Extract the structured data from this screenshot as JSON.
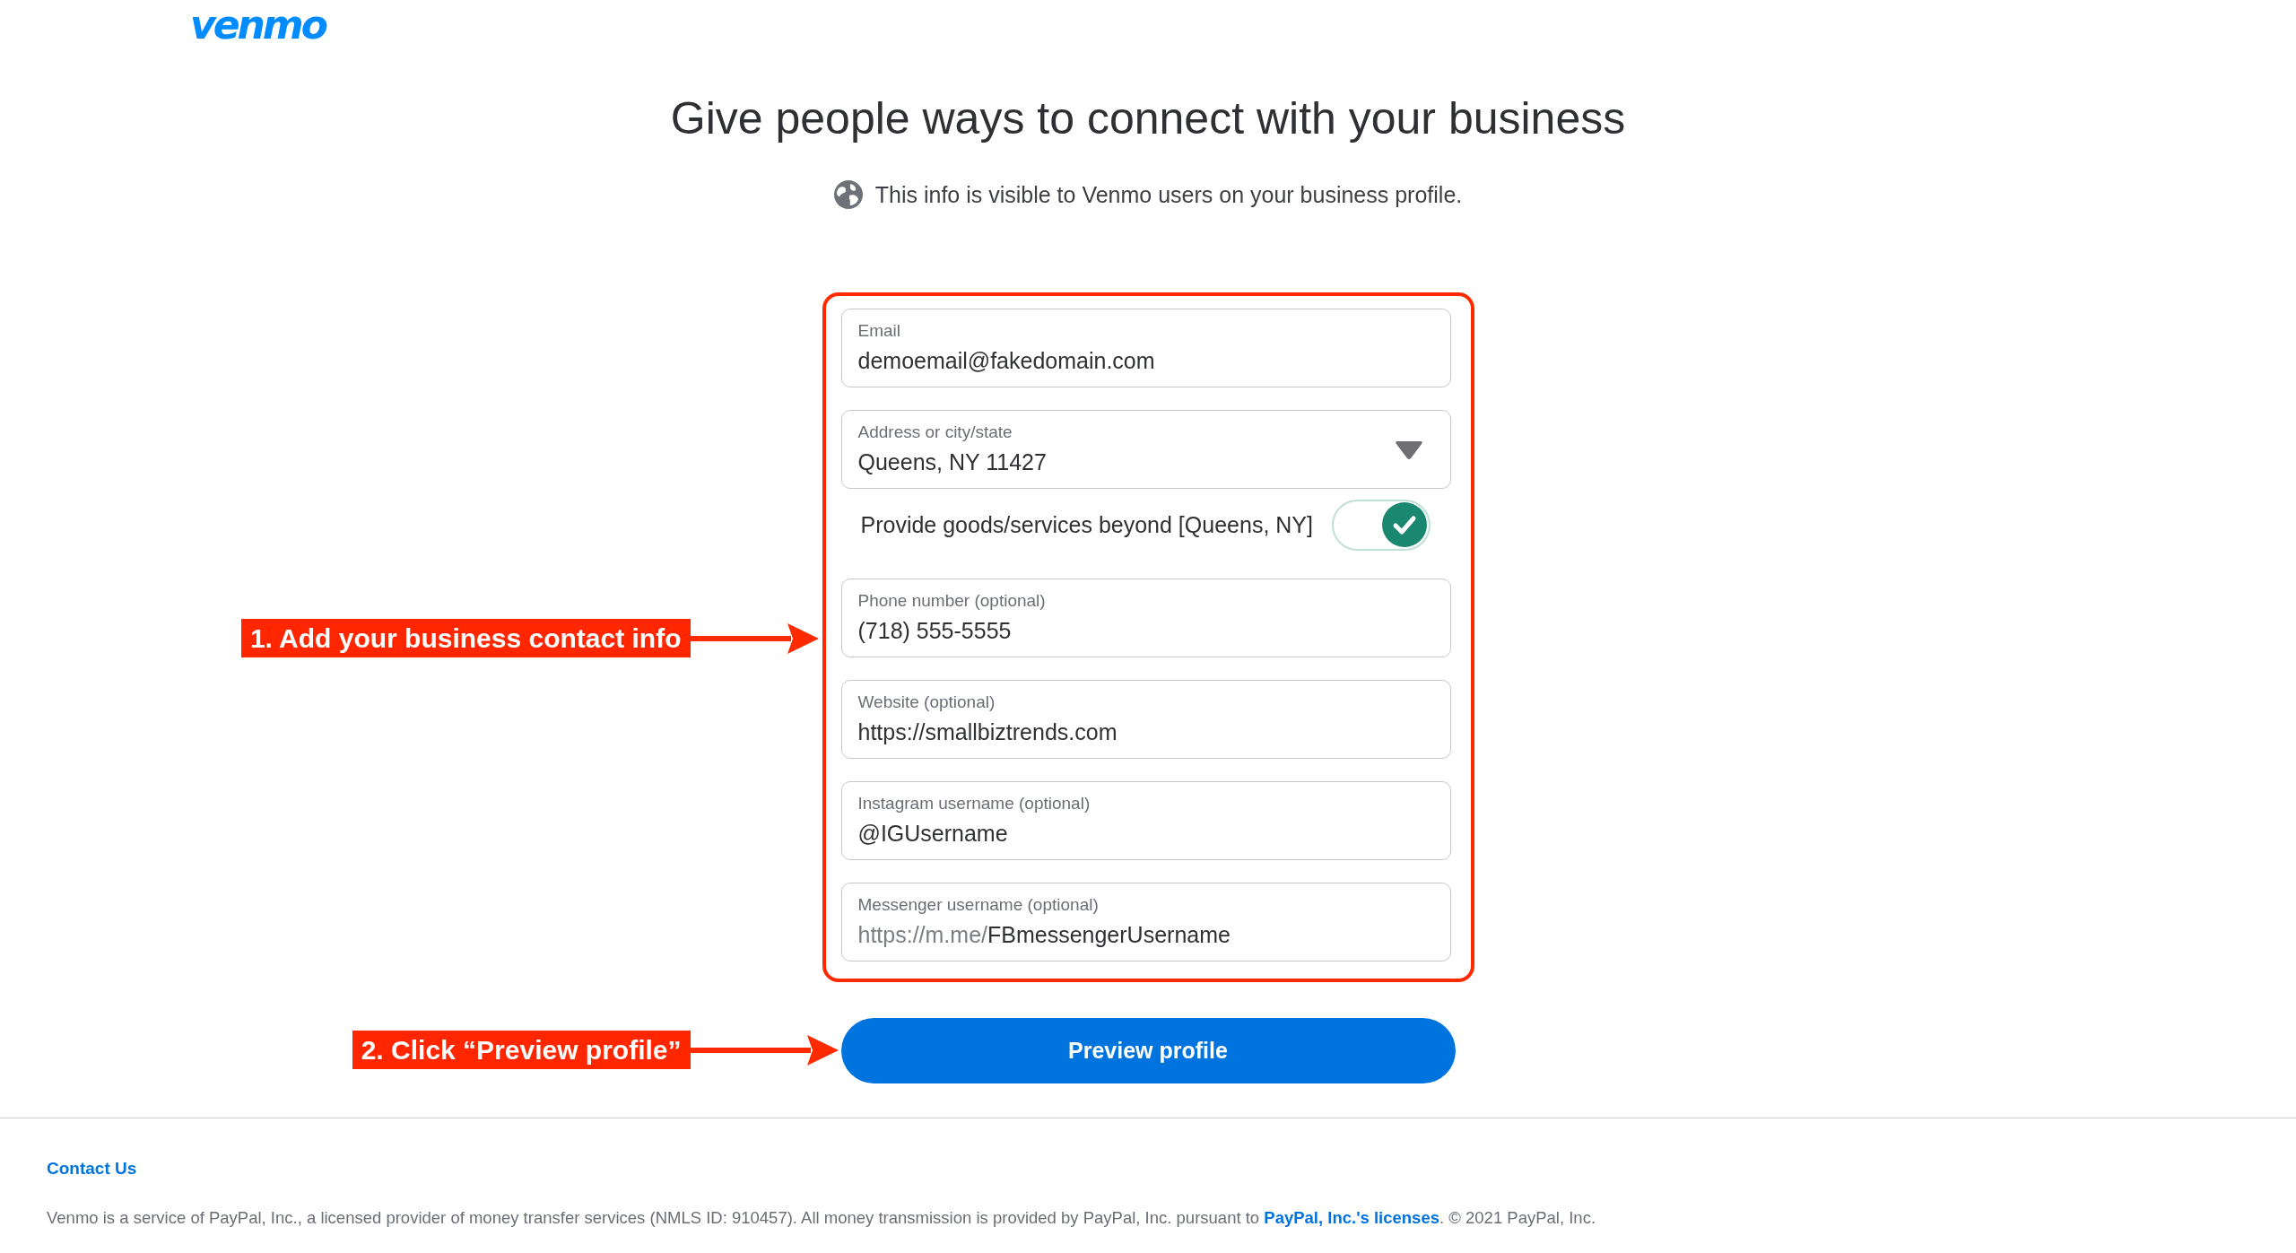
{
  "header": {
    "logo": "venmo"
  },
  "title": "Give people ways to connect with your business",
  "subtitle": "This info is visible to Venmo users on your business profile.",
  "form": {
    "annotation": "1. Add your business contact info",
    "fields": [
      {
        "kind": "text",
        "label": "Email",
        "value": "demoemail@fakedomain.com"
      },
      {
        "kind": "dropdown",
        "label": "Address or city/state",
        "value": "Queens, NY 11427"
      },
      {
        "kind": "toggle",
        "label": "Provide goods/services beyond [Queens, NY]",
        "on": true
      },
      {
        "kind": "text",
        "label": "Phone number (optional)",
        "value": "(718) 555-5555"
      },
      {
        "kind": "text",
        "label": "Website (optional)",
        "value": "https://smallbiztrends.com"
      },
      {
        "kind": "text",
        "label": "Instagram username (optional)",
        "value": "@IGUsername"
      },
      {
        "kind": "text",
        "label": "Messenger username (optional)",
        "prefix": "https://m.me/",
        "value": "FBmessengerUsername"
      }
    ]
  },
  "button": {
    "label": "Preview profile",
    "annotation": "2. Click “Preview profile”"
  },
  "footer": {
    "link": "Contact Us",
    "legal_before": "Venmo is a service of PayPal, Inc., a licensed provider of money transfer services (NMLS ID: 910457). All money transmission is provided by PayPal, Inc. pursuant to ",
    "legal_link": "PayPal, Inc.'s licenses",
    "legal_after": ". © 2021 PayPal, Inc."
  }
}
